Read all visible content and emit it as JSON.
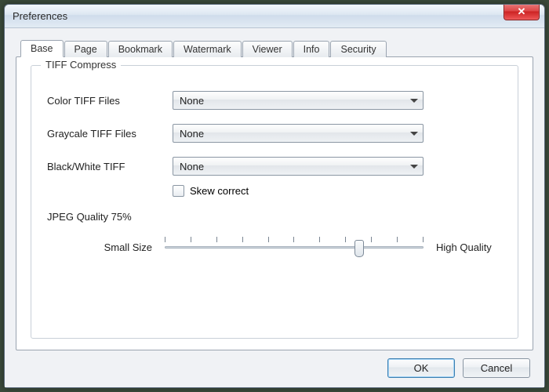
{
  "window": {
    "title": "Preferences",
    "close_glyph": "✕"
  },
  "tabs": [
    {
      "label": "Base"
    },
    {
      "label": "Page"
    },
    {
      "label": "Bookmark"
    },
    {
      "label": "Watermark"
    },
    {
      "label": "Viewer"
    },
    {
      "label": "Info"
    },
    {
      "label": "Security"
    }
  ],
  "group": {
    "legend": "TIFF Compress",
    "rows": {
      "color": {
        "label": "Color TIFF Files",
        "value": "None"
      },
      "gray": {
        "label": "Graycale TIFF Files",
        "value": "None"
      },
      "bw": {
        "label": "Black/White TIFF",
        "value": "None"
      }
    },
    "skew": {
      "label": "Skew correct",
      "checked": false
    },
    "jpeg": {
      "label": "JPEG Quality  75%",
      "small": "Small Size",
      "high": "High Quality",
      "percent": 75
    }
  },
  "buttons": {
    "ok": "OK",
    "cancel": "Cancel"
  }
}
